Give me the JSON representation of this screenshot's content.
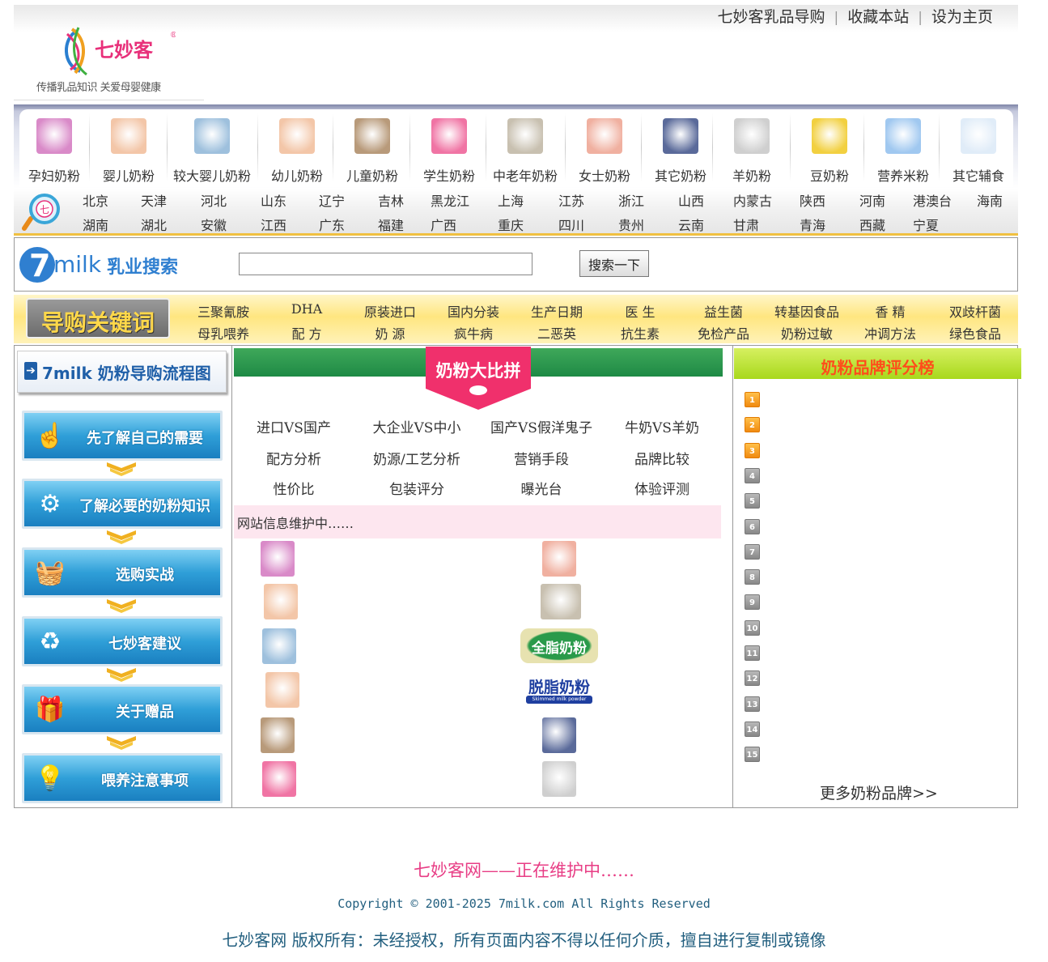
{
  "header": {
    "links": [
      "七妙客乳品导购",
      "收藏本站",
      "设为主页"
    ],
    "logo_text": "七妙客",
    "slogan": "传播乳品知识 关爱母婴健康"
  },
  "categories": [
    "孕妇奶粉",
    "婴儿奶粉",
    "较大婴儿奶粉",
    "幼儿奶粉",
    "儿童奶粉",
    "学生奶粉",
    "中老年奶粉",
    "女士奶粉",
    "其它奶粉",
    "羊奶粉",
    "豆奶粉",
    "营养米粉",
    "其它辅食"
  ],
  "provinces_row1": [
    "北京",
    "天津",
    "河北",
    "山东",
    "辽宁",
    "吉林",
    "黑龙江",
    "上海",
    "江苏",
    "浙江",
    "山西",
    "内蒙古",
    "陕西",
    "河南",
    "港澳台",
    "海南"
  ],
  "provinces_row2": [
    "湖南",
    "湖北",
    "安徽",
    "江西",
    "广东",
    "福建",
    "广西",
    "重庆",
    "四川",
    "贵州",
    "云南",
    "甘肃",
    "青海",
    "西藏",
    "宁夏"
  ],
  "search": {
    "logo_num": "7",
    "logo_word": "milk",
    "logo_cn": "乳业搜索",
    "value": "",
    "button": "搜索一下"
  },
  "keywords": {
    "badge": "导购关键词",
    "row1": [
      "三聚氰胺",
      "DHA",
      "原装进口",
      "国内分装",
      "生产日期",
      "医 生",
      "益生菌",
      "转基因食品",
      "香 精",
      "双歧杆菌"
    ],
    "row2": [
      "母乳喂养",
      "配 方",
      "奶 源",
      "疯牛病",
      "二恶英",
      "抗生素",
      "免检产品",
      "奶粉过敏",
      "冲调方法",
      "绿色食品"
    ]
  },
  "flow": {
    "title": "7milk 奶粉导购流程图",
    "steps": [
      "先了解自己的需要",
      "了解必要的奶粉知识",
      "选购实战",
      "七妙客建议",
      "关于赠品",
      "喂养注意事项"
    ]
  },
  "compare": {
    "title": "奶粉大比拼",
    "items": [
      [
        "进口VS国产",
        "大企业VS中小",
        "国产VS假洋鬼子",
        "牛奶VS羊奶"
      ],
      [
        "配方分析",
        "奶源/工艺分析",
        "营销手段",
        "品牌比较"
      ],
      [
        "性价比",
        "包装评分",
        "曝光台",
        "体验评测"
      ]
    ],
    "notice": "网站信息维护中……",
    "badge_fullfat": "全脂奶粉",
    "badge_skim": "脱脂奶粉",
    "badge_skim_en": "Skimmed milk powder"
  },
  "ranking": {
    "title": "奶粉品牌评分榜",
    "ranks": [
      "1",
      "2",
      "3",
      "4",
      "5",
      "6",
      "7",
      "8",
      "9",
      "10",
      "11",
      "12",
      "13",
      "14",
      "15"
    ],
    "more": "更多奶粉品牌>>"
  },
  "footer": {
    "maintenance": "七妙客网——正在维护中……",
    "copyright": "Copyright ©  2001-2025  7milk.com  All Rights Reserved",
    "rights": "七妙客网    版权所有：未经授权，所有页面内容不得以任何介质，擅自进行复制或镜像"
  }
}
